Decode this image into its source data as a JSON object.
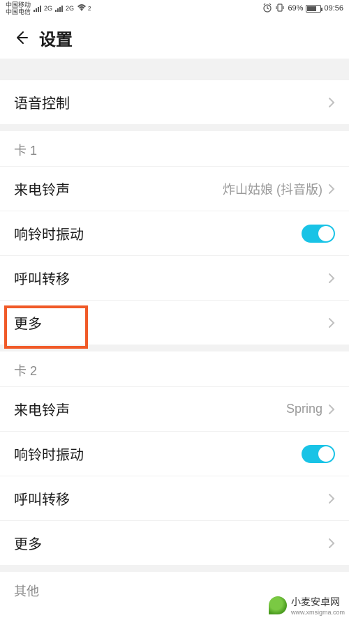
{
  "status": {
    "carrier1": "中国移动",
    "carrier2": "中国电信",
    "net1": "2G",
    "net2": "2G",
    "wifi_idx": "2",
    "battery_pct": "69%",
    "time": "09:56"
  },
  "header": {
    "title": "设置"
  },
  "sections": {
    "voice_control": {
      "label": "语音控制"
    },
    "card1": {
      "header": "卡 1",
      "ringtone_label": "来电铃声",
      "ringtone_value": "炸山姑娘 (抖音版)",
      "vibrate_label": "响铃时振动",
      "vibrate_on": true,
      "forward_label": "呼叫转移",
      "more_label": "更多"
    },
    "card2": {
      "header": "卡 2",
      "ringtone_label": "来电铃声",
      "ringtone_value": "Spring",
      "vibrate_label": "响铃时振动",
      "vibrate_on": true,
      "forward_label": "呼叫转移",
      "more_label": "更多"
    },
    "other": {
      "header": "其他"
    }
  },
  "watermark": {
    "text": "小麦安卓网",
    "url": "www.xmsigma.com"
  }
}
